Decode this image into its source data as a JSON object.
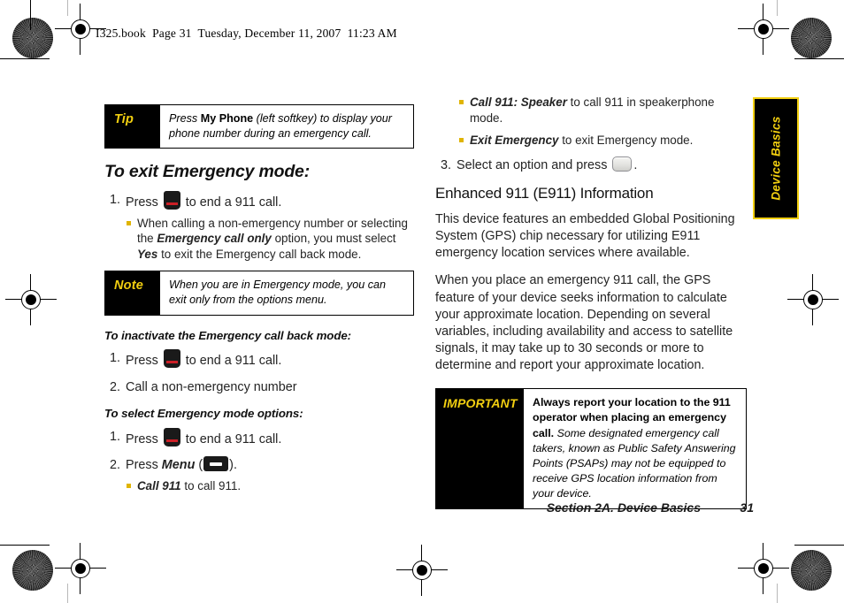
{
  "page_header": "I325.book  Page 31  Tuesday, December 11, 2007  11:23 AM",
  "side_tab": {
    "label": "Device Basics",
    "bg": "#000000",
    "text_color": "#f2cf10",
    "border_color": "#f2cf10"
  },
  "footer": {
    "section": "Section 2A. Device Basics",
    "page_number": "31"
  },
  "colors": {
    "callout_label": "#f2cf10",
    "bullet": "#e0b400",
    "end_key_glyph": "#cc1f26"
  },
  "left_column": {
    "tip_callout": {
      "label": "Tip",
      "text_lead": "Press ",
      "text_bold": "My Phone",
      "text_rest": " (left softkey) to display your phone number during an emergency call."
    },
    "heading": "To exit Emergency mode:",
    "steps_exit": [
      {
        "num": "1.",
        "text_before": "Press ",
        "icon": "end-call-key-icon",
        "text_after": " to end a 911 call."
      }
    ],
    "exit_subbullets": [
      {
        "part1": "When calling a non-emergency number or selecting the ",
        "em1": "Emergency call only",
        "part2": " option, you must select ",
        "em2": "Yes",
        "part3": " to exit the Emergency call back mode."
      }
    ],
    "note_callout": {
      "label": "Note",
      "text": "When you are in Emergency mode, you can exit only from the options menu."
    },
    "minihead_inactivate": "To inactivate the Emergency call back mode:",
    "steps_inactivate": [
      {
        "num": "1.",
        "text_before": "Press ",
        "icon": "end-call-key-icon",
        "text_after": " to end a 911 call."
      },
      {
        "num": "2.",
        "text_before": "Call a non-emergency number",
        "icon": "",
        "text_after": ""
      }
    ],
    "minihead_options": "To select Emergency mode options:",
    "steps_options": [
      {
        "num": "1.",
        "text_before": "Press ",
        "icon": "end-call-key-icon",
        "text_after": " to end a 911 call."
      },
      {
        "num": "2.",
        "text_before": "Press ",
        "em": "Menu",
        "icon": "menu-key-icon",
        "text_open": " (",
        "text_after": ")."
      }
    ],
    "options_bullet_last": {
      "em": "Call 911",
      "rest": " to call 911."
    }
  },
  "right_column": {
    "options_bullets": [
      {
        "em": "Call 911: Speaker",
        "rest": " to call 911 in speakerphone mode."
      },
      {
        "em": "Exit Emergency",
        "rest": " to exit Emergency mode."
      }
    ],
    "step3": {
      "num": "3.",
      "text_before": "Select an option and press ",
      "icon": "select-key-icon",
      "text_after": "."
    },
    "heading": "Enhanced 911 (E911) Information",
    "paragraphs": [
      "This device features an embedded Global Positioning System (GPS) chip necessary for utilizing E911 emergency location services where available.",
      "When you place an emergency 911 call, the GPS feature of your device seeks information to calculate your approximate location. Depending on several variables, including availability and access to satellite signals, it may take up to 30 seconds or more to determine and report your approximate location."
    ],
    "important_callout": {
      "label": "IMPORTANT",
      "bold_lead": "Always report your location to the 911 operator when placing an emergency call.",
      "italic_rest": " Some designated emergency call takers, known as Public Safety Answering Points (PSAPs) may not be equipped to receive GPS location information from your device."
    }
  }
}
